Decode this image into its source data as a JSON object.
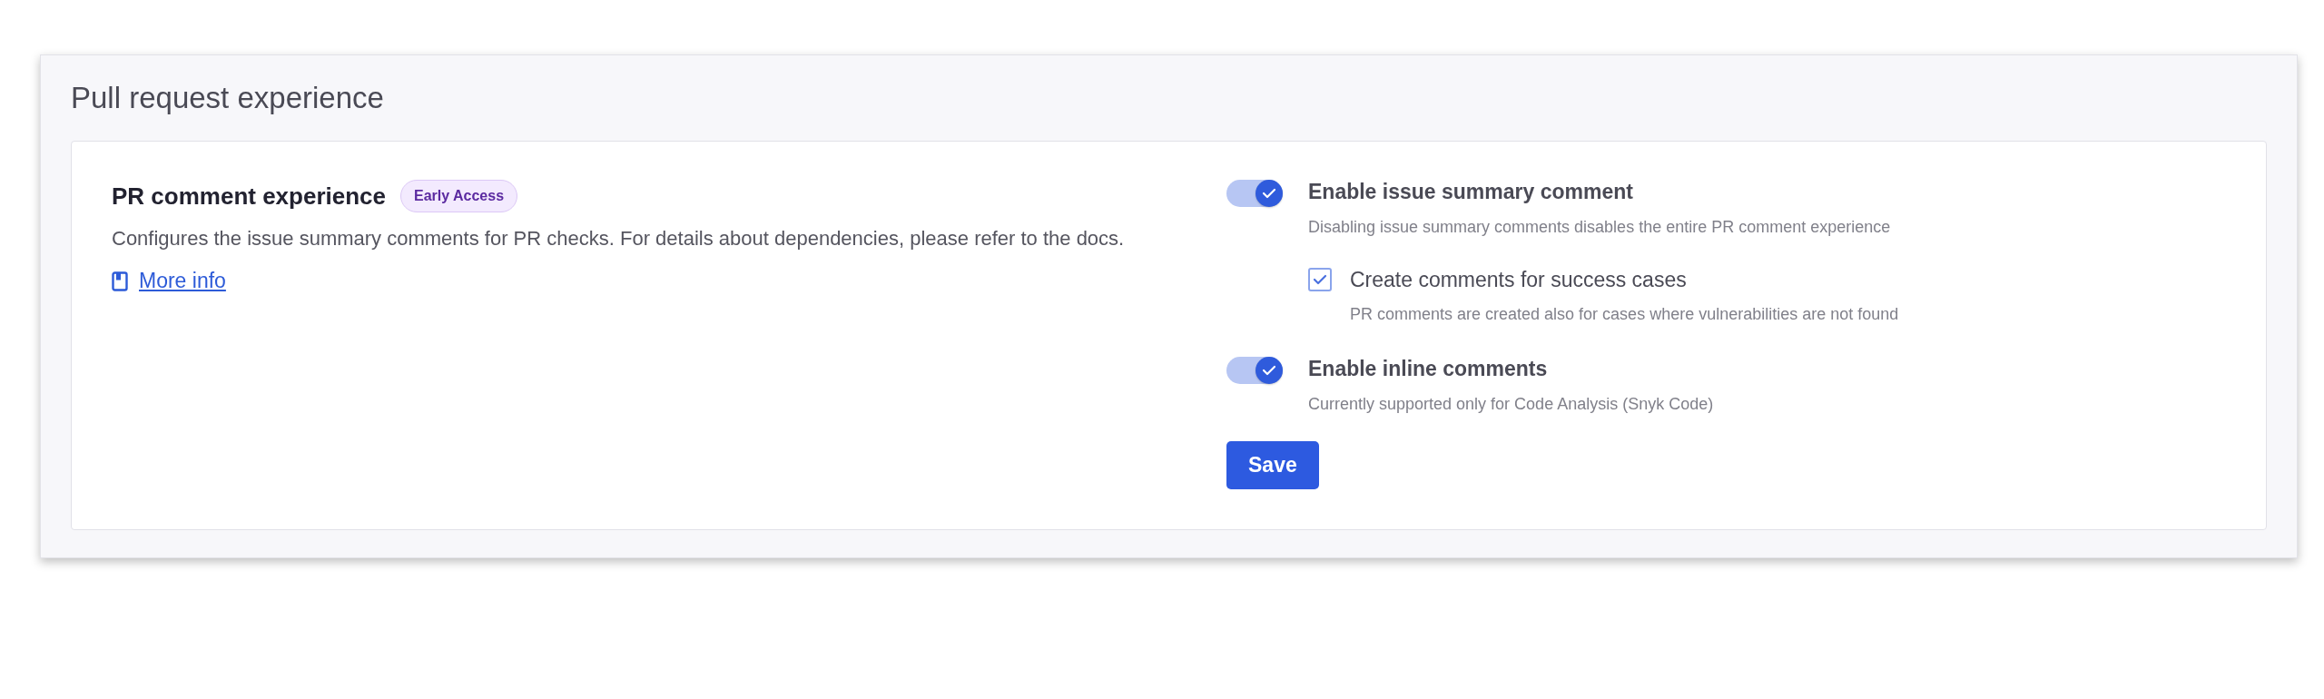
{
  "section": {
    "title": "Pull request experience"
  },
  "setting": {
    "title": "PR comment experience",
    "badge": "Early Access",
    "description": "Configures the issue summary comments for PR checks. For details about dependencies, please refer to the docs.",
    "link": "More info"
  },
  "options": [
    {
      "kind": "toggle",
      "label": "Enable issue summary comment",
      "help": "Disabling issue summary comments disables the entire PR comment experience",
      "on": true,
      "children": [
        {
          "kind": "checkbox",
          "label": "Create comments for success cases",
          "help": "PR comments are created also for cases where vulnerabilities are not found",
          "checked": true
        }
      ]
    },
    {
      "kind": "toggle",
      "label": "Enable inline comments",
      "help": "Currently supported only for Code Analysis (Snyk Code)",
      "on": true
    }
  ],
  "save_button": "Save"
}
